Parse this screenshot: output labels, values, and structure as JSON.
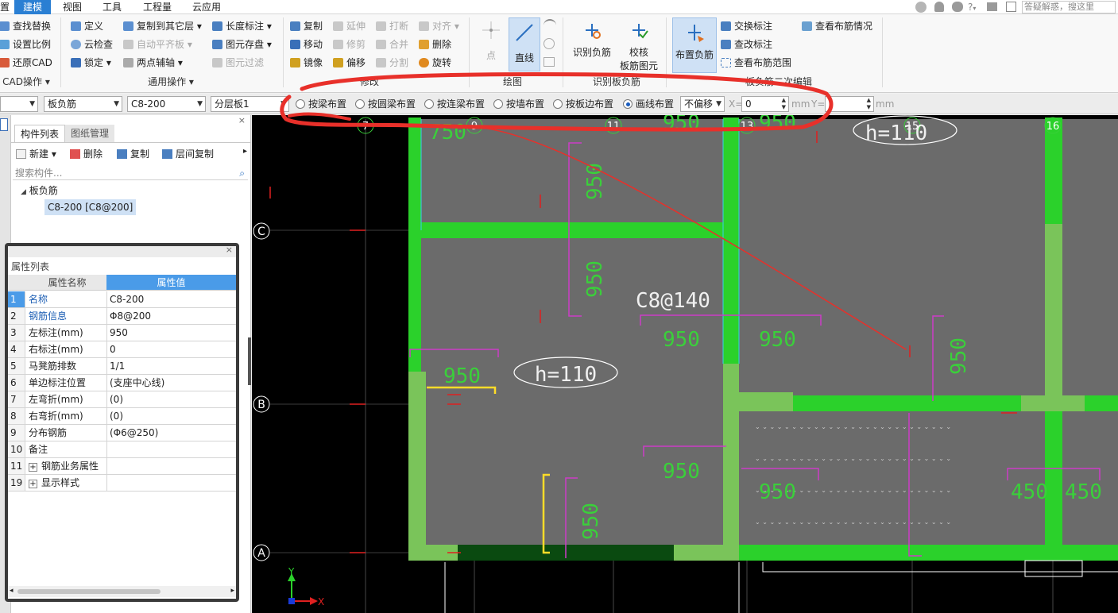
{
  "menu": {
    "items": [
      "建模",
      "视图",
      "工具",
      "工程量",
      "云应用"
    ],
    "cut_left": "置",
    "search_placeholder": "答疑解惑，搜这里"
  },
  "ribbon": {
    "cad": {
      "find_replace": "查找替换",
      "set_scale": "设置比例",
      "restore_cad": "还原CAD",
      "group": "CAD操作"
    },
    "general": {
      "define": "定义",
      "copy_to_layer": "复制到其它层",
      "length_mark": "长度标注",
      "cloud_check": "云检查",
      "auto_align": "自动平齐板",
      "save_element": "图元存盘",
      "lock": "锁定",
      "two_point_axis": "两点辅轴",
      "element_filter": "图元过滤",
      "group": "通用操作"
    },
    "modify": {
      "copy": "复制",
      "extend": "延伸",
      "break": "打断",
      "align": "对齐",
      "move": "移动",
      "trim": "修剪",
      "merge": "合并",
      "delete": "删除",
      "mirror": "镜像",
      "offset": "偏移",
      "split": "分割",
      "rotate": "旋转",
      "group": "修改"
    },
    "draw": {
      "point": "点",
      "line": "直线",
      "group": "绘图"
    },
    "identify": {
      "identify_neg": "识别负筋",
      "check_line1": "校核",
      "check_line2": "板筋图元",
      "group": "识别板负筋"
    },
    "edit": {
      "place_neg": "布置负筋",
      "swap_mark": "交换标注",
      "view_rebar": "查看布筋情况",
      "modify_mark": "查改标注",
      "view_range": "查看布筋范围",
      "group": "板负筋二次编辑"
    }
  },
  "options": {
    "combo1": "",
    "combo2": "板负筋",
    "combo3": "C8-200",
    "combo4": "分层板1",
    "radios": [
      "按梁布置",
      "按圆梁布置",
      "按连梁布置",
      "按墙布置",
      "按板边布置",
      "画线布置"
    ],
    "selected_radio": "画线布置",
    "offset_value": "不偏移",
    "x_label": "X=",
    "x_value": "0",
    "unit": "mm",
    "y_label": "Y=",
    "y_value": ""
  },
  "component_panel": {
    "tab_list": "构件列表",
    "tab_drawings": "图纸管理",
    "new_label": "新建",
    "delete_label": "删除",
    "copy_label": "复制",
    "layer_copy_label": "层间复制",
    "search_placeholder": "搜索构件...",
    "tree_parent": "板负筋",
    "tree_child": "C8-200 [C8@200]"
  },
  "property_panel": {
    "title": "属性列表",
    "col_name": "属性名称",
    "col_value": "属性值",
    "rows": [
      {
        "n": "1",
        "name": "名称",
        "value": "C8-200",
        "blue": true
      },
      {
        "n": "2",
        "name": "钢筋信息",
        "value": "Φ8@200",
        "blue": true
      },
      {
        "n": "3",
        "name": "左标注(mm)",
        "value": "950",
        "blue": false
      },
      {
        "n": "4",
        "name": "右标注(mm)",
        "value": "0",
        "blue": false
      },
      {
        "n": "5",
        "name": "马凳筋排数",
        "value": "1/1",
        "blue": false
      },
      {
        "n": "6",
        "name": "单边标注位置",
        "value": "(支座中心线)",
        "blue": false
      },
      {
        "n": "7",
        "name": "左弯折(mm)",
        "value": "(0)",
        "blue": false
      },
      {
        "n": "8",
        "name": "右弯折(mm)",
        "value": "(0)",
        "blue": false
      },
      {
        "n": "9",
        "name": "分布钢筋",
        "value": "(Φ6@250)",
        "blue": false
      },
      {
        "n": "10",
        "name": "备注",
        "value": "",
        "blue": false
      },
      {
        "n": "11",
        "name": "钢筋业务属性",
        "value": "",
        "blue": false
      },
      {
        "n": "19",
        "name": "显示样式",
        "value": "",
        "blue": false
      }
    ]
  },
  "drawing": {
    "axis_labels": {
      "a7": "7",
      "a9": "9",
      "a11": "11",
      "a13": "13",
      "a15": "15",
      "a16": "16",
      "aC": "C",
      "aB": "B",
      "aA": "A"
    },
    "dims": {
      "d750": "750",
      "d950": "950",
      "d450": "450"
    },
    "rebar_label": "C8@140",
    "thickness": "h=110",
    "ucs_x": "X",
    "ucs_y": "Y"
  },
  "colors": {
    "accent": "#2a7fd3",
    "beam": "#2bd12b",
    "slab": "#6b6b6b",
    "dim": "#3ad03a",
    "annot": "#cc3cc8",
    "highlight": "#e8302a"
  }
}
